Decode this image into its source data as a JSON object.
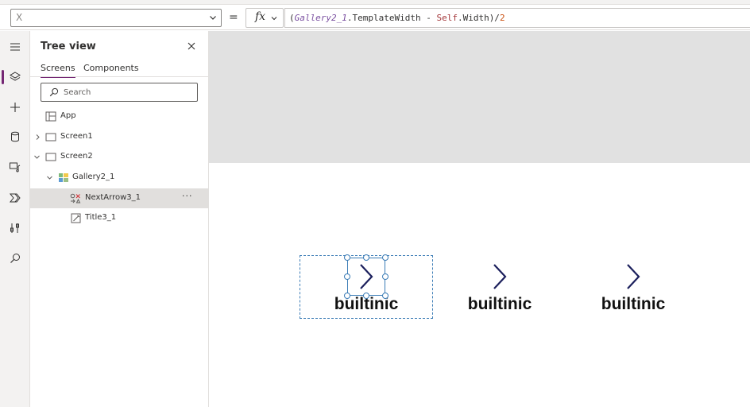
{
  "formula_bar": {
    "property": "X",
    "equals": "=",
    "fx_label": "fx",
    "formula": {
      "open": "(",
      "control": "Gallery2_1",
      "prop1": ".TemplateWidth - ",
      "self": "Self",
      "prop2": ".Width)/",
      "number": "2"
    }
  },
  "rail": {
    "items": [
      {
        "icon": "hamburger-menu-icon"
      },
      {
        "icon": "layers-icon",
        "active": true
      },
      {
        "icon": "plus-icon"
      },
      {
        "icon": "database-icon"
      },
      {
        "icon": "media-icon"
      },
      {
        "icon": "power-automate-icon"
      },
      {
        "icon": "tools-icon"
      },
      {
        "icon": "search-icon"
      }
    ]
  },
  "tree": {
    "title": "Tree view",
    "tabs": [
      "Screens",
      "Components"
    ],
    "search_placeholder": "Search",
    "nodes": [
      {
        "label": "App",
        "icon": "app-icon"
      },
      {
        "label": "Screen1",
        "icon": "screen-icon",
        "expanded": false
      },
      {
        "label": "Screen2",
        "icon": "screen-icon",
        "expanded": true
      },
      {
        "label": "Gallery2_1",
        "icon": "gallery-icon",
        "expanded": true
      },
      {
        "label": "NextArrow3_1",
        "icon": "icon-control-icon",
        "selected": true,
        "more": "···"
      },
      {
        "label": "Title3_1",
        "icon": "label-icon"
      }
    ]
  },
  "canvas": {
    "items": [
      {
        "title": "builtinic"
      },
      {
        "title": "builtinic"
      },
      {
        "title": "builtinic"
      }
    ],
    "arrow_color": "#1b1f5c"
  },
  "colors": {
    "accent": "#742774",
    "selection": "#3b7cb6",
    "canvas_background": "#e1e1e1"
  }
}
